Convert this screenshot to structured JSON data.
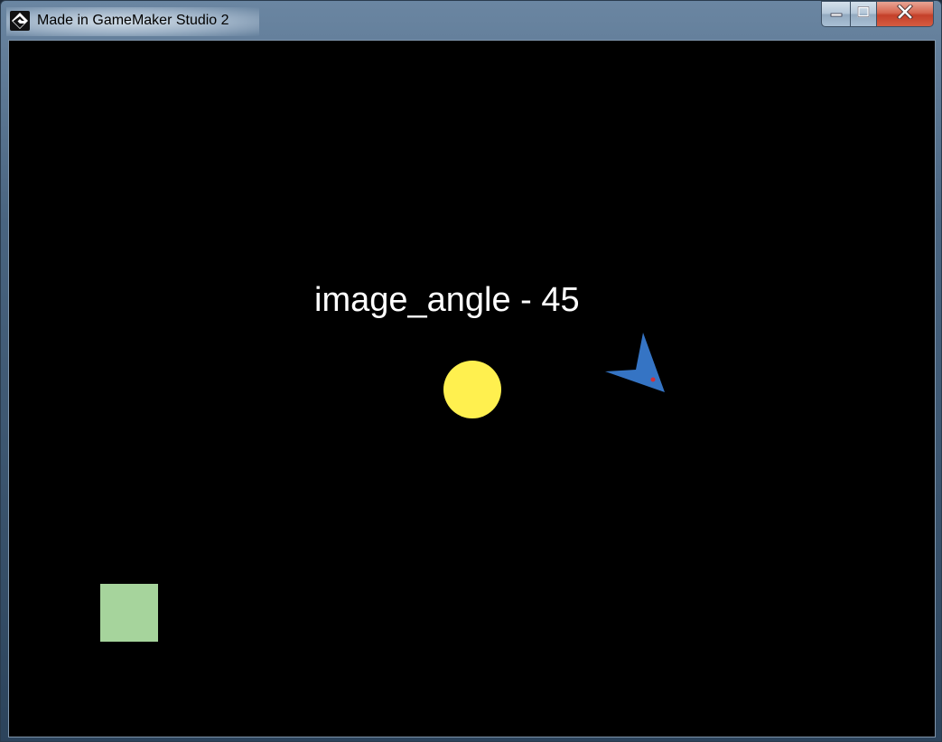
{
  "window": {
    "title": "Made in GameMaker Studio 2",
    "app_icon": "gamemaker-logo-icon",
    "controls": {
      "minimize_icon": "minimize-icon",
      "maximize_icon": "maximize-icon",
      "close_icon": "close-icon"
    }
  },
  "game": {
    "background_color": "#000000",
    "label": "image_angle - 45",
    "objects": {
      "sun": {
        "color": "#fff04f"
      },
      "arrow": {
        "color": "#3574c4",
        "dot_color": "#d0303a"
      },
      "square": {
        "color": "#a6d49c"
      }
    }
  }
}
